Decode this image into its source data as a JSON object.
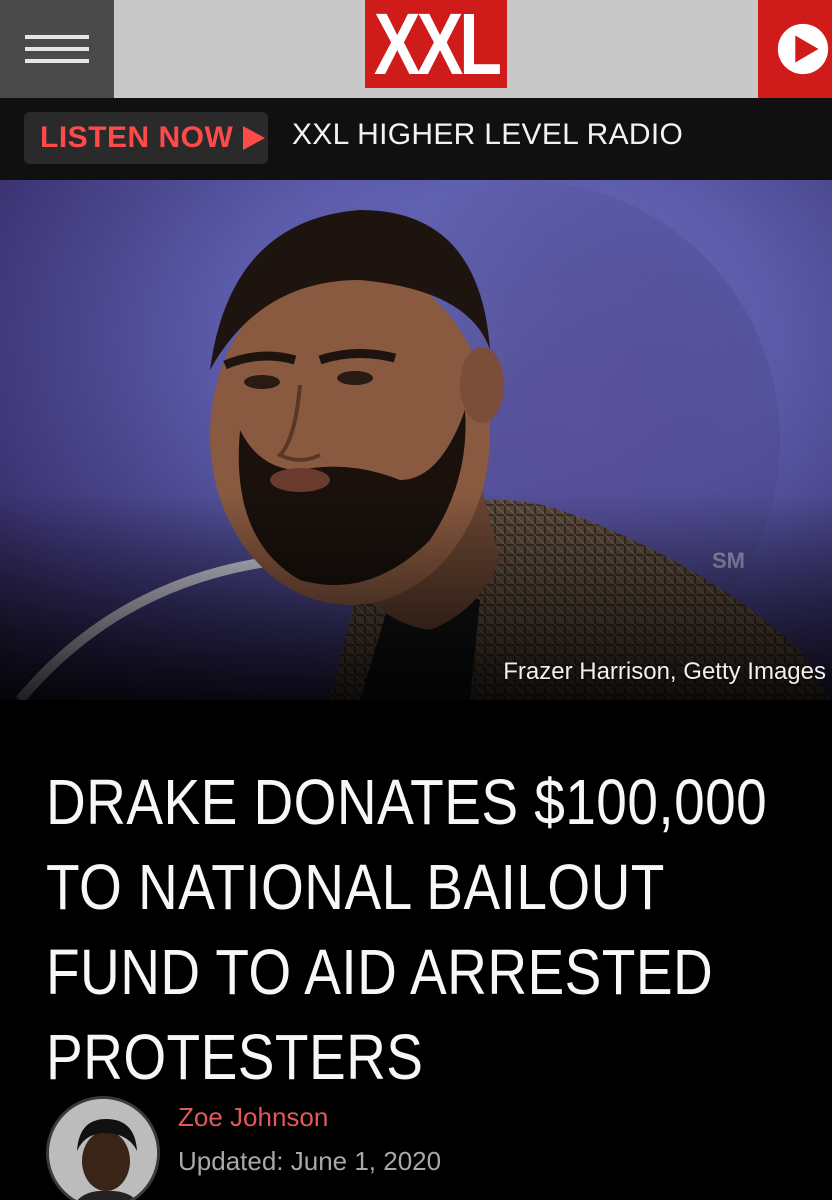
{
  "header": {
    "logo_text": "XXL",
    "brand_color": "#d01b1b",
    "menu_icon": "hamburger-menu-icon",
    "play_icon": "play-icon"
  },
  "radio": {
    "listen_label": "LISTEN NOW",
    "listen_icon": "triangle-right-icon",
    "station_name": "XXL HIGHER LEVEL RADIO"
  },
  "hero": {
    "caption": "Frazer Harrison, Getty Images",
    "backdrop_mark": "SM"
  },
  "article": {
    "headline": "DRAKE DONATES $100,000 TO NATIONAL BAILOUT FUND TO AID ARRESTED PROTESTERS",
    "author": "Zoe Johnson",
    "updated": "Updated: June 1, 2020"
  }
}
